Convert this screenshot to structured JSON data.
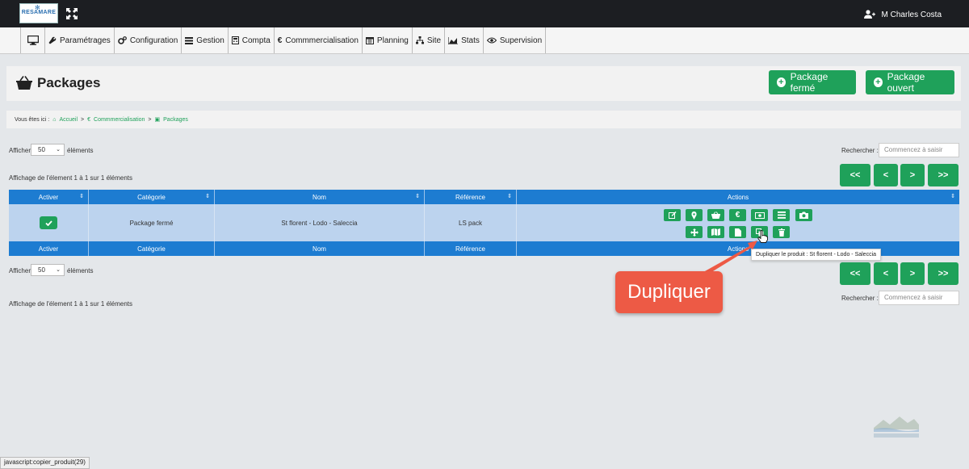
{
  "app": {
    "logo_text": "RESAMARE",
    "user_name": "M Charles Costa"
  },
  "menu": [
    {
      "label": "",
      "icon": "monitor-icon"
    },
    {
      "label": "Paramétrages",
      "icon": "wrench-icon"
    },
    {
      "label": "Configuration",
      "icon": "gears-icon"
    },
    {
      "label": "Gestion",
      "icon": "list-icon"
    },
    {
      "label": "Compta",
      "icon": "calculator-icon"
    },
    {
      "label": "Commmercialisation",
      "icon": "euro-icon"
    },
    {
      "label": "Planning",
      "icon": "calendar-icon"
    },
    {
      "label": "Site",
      "icon": "sitemap-icon"
    },
    {
      "label": "Stats",
      "icon": "chart-icon"
    },
    {
      "label": "Supervision",
      "icon": "eye-icon"
    }
  ],
  "page": {
    "title": "Packages",
    "btn_closed": "Package fermé",
    "btn_open": "Package ouvert"
  },
  "breadcrumb": {
    "prefix": "Vous êtes ici :",
    "items": [
      "Accueil",
      "Commmercialisation",
      "Packages"
    ],
    "sep": ">"
  },
  "controls": {
    "show": "Afficher",
    "page_size": "50",
    "elements": "éléments",
    "info": "Affichage de l'élement 1 à 1 sur 1 éléments",
    "search_label": "Rechercher :",
    "search_placeholder": "Commencez à saisir",
    "pg_first": "<<",
    "pg_prev": "<",
    "pg_next": ">",
    "pg_last": ">>"
  },
  "table": {
    "headers": [
      "Activer",
      "Catégorie",
      "Nom",
      "Référence",
      "Actions"
    ],
    "footer": [
      "Activer",
      "Catégorie",
      "Nom",
      "Référence",
      "Actions"
    ],
    "row": {
      "category": "Package fermé",
      "name": "St florent - Lodo - Saleccia",
      "reference": "LS pack"
    }
  },
  "tooltip": "Dupliquer le produit : St florent - Lodo - Saleccia",
  "callout": "Dupliquer",
  "status_url": "javascript:copier_produit(29)",
  "colors": {
    "green": "#1fa15a",
    "blue_header": "#1d7cd1",
    "row_selected": "#bcd3ee",
    "callout": "#ed5a45",
    "topbar": "#1c1e22"
  }
}
